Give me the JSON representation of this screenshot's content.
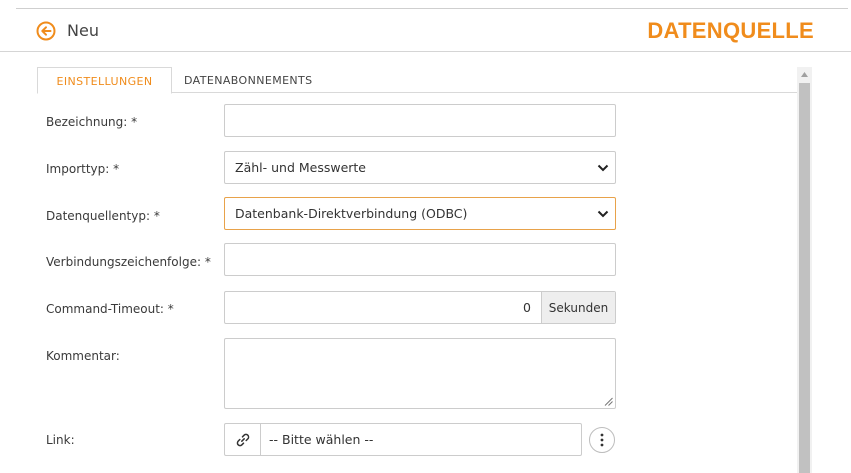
{
  "header": {
    "back_label": "Neu",
    "brand": "DATENQUELLE",
    "accent_color": "#f08c1c"
  },
  "tabs": [
    {
      "label": "EINSTELLUNGEN",
      "active": true
    },
    {
      "label": "DATENABONNEMENTS",
      "active": false
    }
  ],
  "form": {
    "bezeichnung": {
      "label": "Bezeichnung: *",
      "value": ""
    },
    "importtyp": {
      "label": "Importtyp: *",
      "value": "Zähl- und Messwerte"
    },
    "datenquellentyp": {
      "label": "Datenquellentyp: *",
      "value": "Datenbank-Direktverbindung (ODBC)"
    },
    "verbindung": {
      "label": "Verbindungszeichenfolge: *",
      "value": ""
    },
    "timeout": {
      "label": "Command-Timeout: *",
      "value": "0",
      "unit": "Sekunden"
    },
    "kommentar": {
      "label": "Kommentar:",
      "value": ""
    },
    "link": {
      "label": "Link:",
      "placeholder": "-- Bitte wählen --"
    }
  },
  "icons": {
    "back": "circle-arrow-left-icon",
    "link": "chain-link-icon",
    "menu": "vertical-dots-icon"
  }
}
